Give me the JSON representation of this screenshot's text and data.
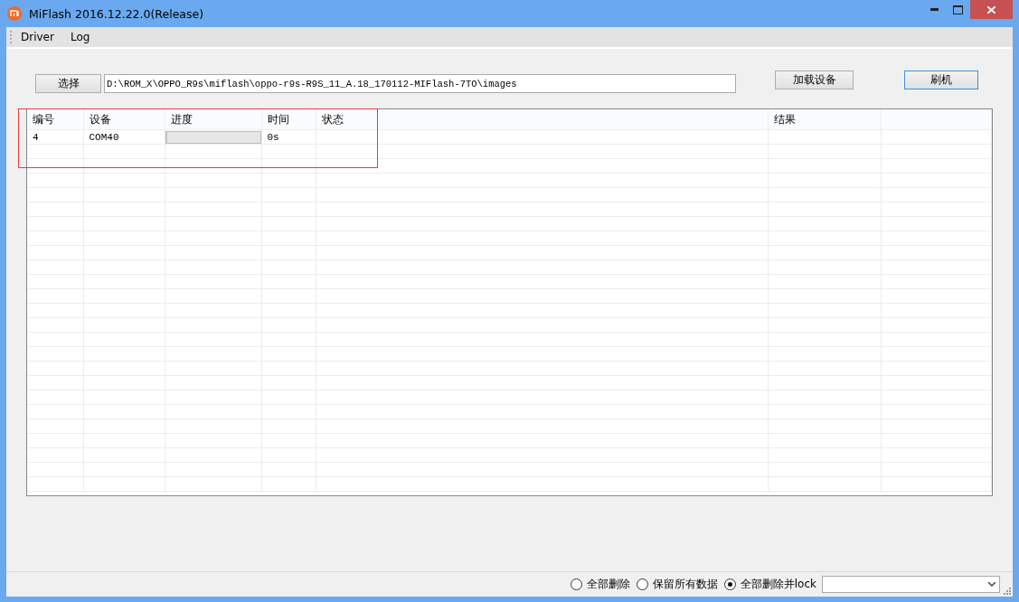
{
  "window": {
    "title": "MiFlash 2016.12.22.0(Release)"
  },
  "menu": [
    "Driver",
    "Log"
  ],
  "toolbar": {
    "select_button": "选择",
    "path": {
      "value": "D:\\ROM_X\\OPPO_R9s\\miflash\\oppo-r9s-R9S_11_A.18_170112-MIFlash-7TO\\images"
    },
    "load_button": "加载设备",
    "flash_button": {
      "label": "刷机",
      "focused": true
    }
  },
  "table": {
    "columns": [
      "编号",
      "设备",
      "进度",
      "时间",
      "状态",
      "结果"
    ],
    "rows": [
      {
        "number": "4",
        "device": "COM40",
        "level": 0,
        "time": "0s"
      }
    ]
  },
  "options": [
    {
      "label": "全部删除",
      "selected": false
    },
    {
      "label": "保留所有数据",
      "selected": false
    },
    {
      "label": "全部删除并lock",
      "selected": true
    }
  ]
}
